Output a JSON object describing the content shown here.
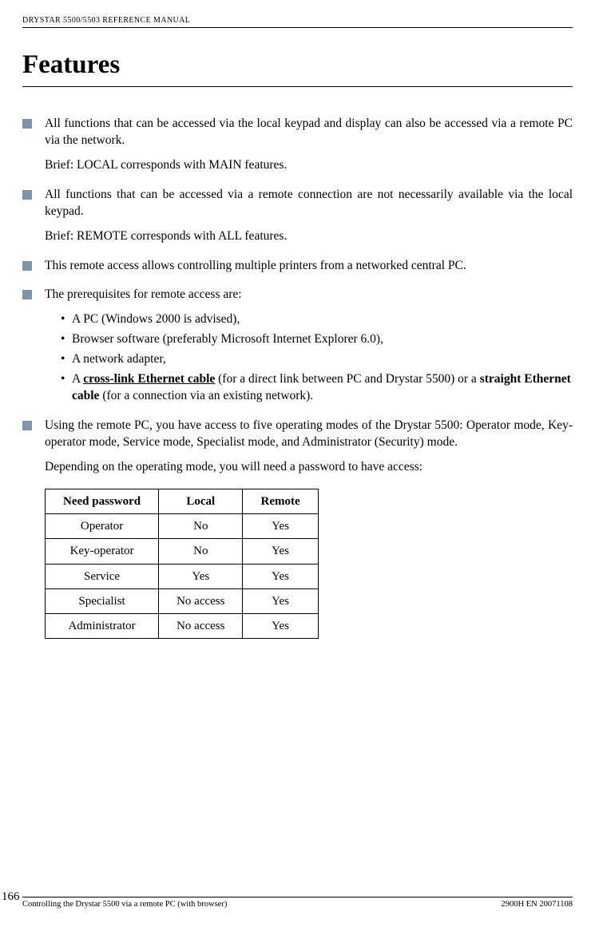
{
  "header": "DRYSTAR 5500/5503 REFERENCE MANUAL",
  "title": "Features",
  "blocks": {
    "b1p1": "All functions that can be accessed via the local keypad and display can also be accessed via a remote PC via the network.",
    "b1p2": "Brief: LOCAL corresponds with MAIN features.",
    "b2p1": "All functions that can be accessed via a remote connection are not necessarily available via the local keypad.",
    "b2p2": "Brief: REMOTE corresponds with ALL features.",
    "b3p1": "This remote access allows controlling multiple printers from a networked central PC.",
    "b4p1": "The prerequisites for remote access are:",
    "b4li1": "A PC (Windows 2000 is advised),",
    "b4li2": "Browser software (preferably Microsoft Internet Explorer 6.0),",
    "b4li3": "A network adapter,",
    "b4li4a": "A ",
    "b4li4b": "cross-link Ethernet cable",
    "b4li4c": " (for a direct link between PC and Drystar 5500) or a ",
    "b4li4d": "straight Ethernet cable",
    "b4li4e": " (for a connection via an existing network).",
    "b5p1": "Using the remote PC, you have access to five operating modes of the Drystar 5500: Operator mode, Key-operator mode, Service mode, Specialist mode, and Administrator (Security) mode.",
    "b5p2": "Depending on the operating mode, you will need a password to have access:"
  },
  "table": {
    "h1": "Need password",
    "h2": "Local",
    "h3": "Remote",
    "rows": [
      {
        "c1": "Operator",
        "c2": "No",
        "c3": "Yes"
      },
      {
        "c1": "Key-operator",
        "c2": "No",
        "c3": "Yes"
      },
      {
        "c1": "Service",
        "c2": "Yes",
        "c3": "Yes"
      },
      {
        "c1": "Specialist",
        "c2": "No access",
        "c3": "Yes"
      },
      {
        "c1": "Administrator",
        "c2": "No access",
        "c3": "Yes"
      }
    ]
  },
  "footer": {
    "pagenum": "166",
    "left": "Controlling the Drystar 5500 via a remote PC (with browser)",
    "right": "2900H EN 20071108"
  }
}
